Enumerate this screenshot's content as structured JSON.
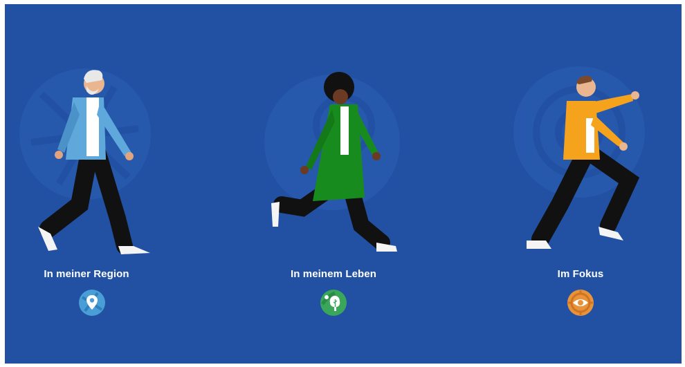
{
  "colors": {
    "background": "#2251a4",
    "watermark": "#2b5eb4",
    "label_text": "#ffffff",
    "region_icon_bg": "#4a9ed6",
    "leben_icon_bg": "#3aa65a",
    "fokus_icon_bg": "#e8923a"
  },
  "cards": [
    {
      "label": "In meiner Region",
      "icon": "map-pin-icon",
      "figure": "walking-man-blue-jacket"
    },
    {
      "label": "In meinem Leben",
      "icon": "tree-icon",
      "figure": "walking-woman-green-coat"
    },
    {
      "label": "Im Fokus",
      "icon": "eye-target-icon",
      "figure": "pointing-man-yellow-shirt"
    }
  ]
}
